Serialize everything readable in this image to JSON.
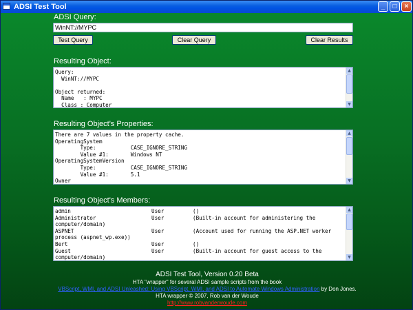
{
  "window": {
    "title": "ADSI Test Tool",
    "controls": {
      "minimize": "_",
      "maximize": "□",
      "close": "×"
    }
  },
  "query": {
    "label": "ADSI Query:",
    "value": "WinNT://MYPC"
  },
  "buttons": {
    "test_query": "Test Query",
    "clear_query": "Clear Query",
    "clear_results": "Clear Results"
  },
  "resulting_object": {
    "label": "Resulting Object:",
    "text": "Query:\n  WinNT://MYPC\n\nObject returned:\n  Name   : MYPC\n  Class : Computer"
  },
  "resulting_properties": {
    "label": "Resulting Object's Properties:",
    "text": "There are 7 values in the property cache.\nOperatingSystem\n        Type:           CASE_IGNORE_STRING\n        Value #1:       Windows NT\nOperatingSystemVersion\n        Type:           CASE_IGNORE_STRING\n        Value #1:       5.1\nOwner"
  },
  "resulting_members": {
    "label": "Resulting Object's Members:",
    "rows": [
      {
        "name": "admin",
        "class": "User",
        "description": "()"
      },
      {
        "name": "Administrator",
        "class": "User",
        "description": "(Built-in account for administering the"
      },
      {
        "name": "computer/domain)",
        "class": "",
        "description": ""
      },
      {
        "name": "ASPNET",
        "class": "User",
        "description": "(Account used for running the ASP.NET worker"
      },
      {
        "name": "process (aspnet_wp.exe))",
        "class": "",
        "description": ""
      },
      {
        "name": "Bert",
        "class": "User",
        "description": "()"
      },
      {
        "name": "Guest",
        "class": "User",
        "description": "(Built-in account for guest access to the"
      },
      {
        "name": "computer/domain)",
        "class": "",
        "description": ""
      }
    ]
  },
  "footer": {
    "title": "ADSI Test Tool,  Version 0.20 Beta",
    "line2": "HTA \"wrapper\" for several ADSI sample scripts from the book",
    "book_link": "VBScript, WMI, and ADSI Unleashed: Using VBScript, WMI, and ADSI to Automate Windows Administration",
    "book_author": " by Don Jones.",
    "line4": "HTA wrapper © 2007,  Rob van der Woude",
    "site_link": "http://www.robvanderwoude.com"
  },
  "colors": {
    "background_top": "#0a8a2c",
    "background_bottom": "#034212",
    "titlebar": "#0054e3",
    "link": "#3060ff",
    "site_link": "#ff2020"
  }
}
